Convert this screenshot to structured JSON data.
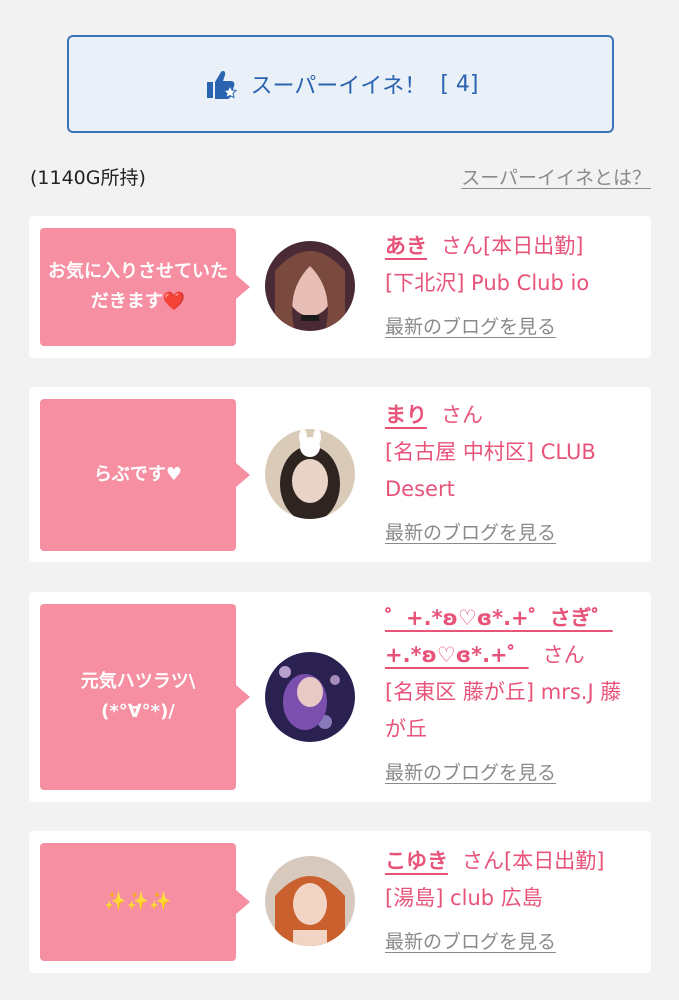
{
  "super_button": {
    "label": "スーパーイイネ！",
    "count": "[ 4]"
  },
  "points": "(1140G所持)",
  "what_link": "スーパーイイネとは？",
  "blog_link_label": "最新のブログを見る",
  "cards": [
    {
      "message": "お気に入りさせていただきます❤️",
      "name": "あき",
      "suffix": "さん[本日出勤]",
      "shop": "[下北沢] Pub Club io"
    },
    {
      "message": "らぶです♥",
      "name": "まり",
      "suffix": "さん",
      "shop": "[名古屋 中村区] CLUB Desert"
    },
    {
      "message": "元気ハツラツ\\(*°∀°*)/",
      "name": "゜+.*ʚ♡ɞ*.+゜さぎ゜+.*ʚ♡ɞ*.+゜",
      "suffix": "さん",
      "shop": "[名東区 藤が丘] mrs.J 藤が丘"
    },
    {
      "message": "✨✨✨",
      "name": "こゆき",
      "suffix": "さん[本日出勤]",
      "shop": "[湯島] club 広島"
    }
  ],
  "colors": {
    "accent_pink": "#e8537a",
    "bubble_pink": "#f58fa1",
    "button_blue": "#2a64b0"
  }
}
